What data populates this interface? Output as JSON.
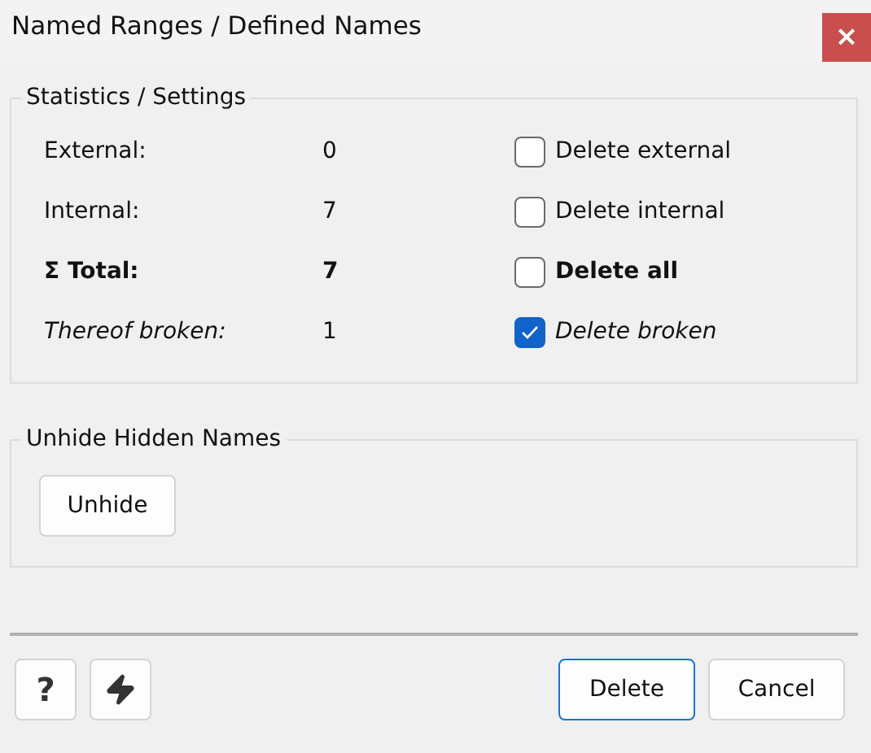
{
  "window": {
    "title": "Named Ranges / Defined Names",
    "close": "×"
  },
  "statistics": {
    "title": "Statistics / Settings",
    "rows": [
      {
        "label": "External:",
        "value": "0",
        "option": "Delete external",
        "checked": false,
        "kind": "count"
      },
      {
        "label": "Internal:",
        "value": "7",
        "option": "Delete internal",
        "checked": false,
        "kind": "count"
      },
      {
        "label": "Σ Total:",
        "value": "7",
        "option": "Delete all",
        "checked": false,
        "kind": "total"
      },
      {
        "label": "Thereof broken:",
        "value": "1",
        "option": "Delete broken",
        "checked": true,
        "kind": "subset"
      }
    ]
  },
  "unhide": {
    "title": "Unhide Hidden Names",
    "button": "Unhide"
  },
  "footer": {
    "help": "?",
    "buttons": [
      {
        "label": "Delete",
        "default": true
      },
      {
        "label": "Cancel",
        "default": false
      }
    ]
  }
}
